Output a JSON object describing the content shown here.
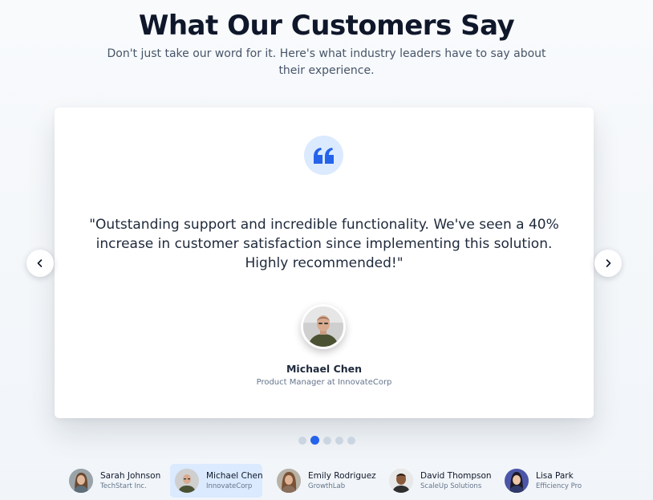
{
  "header": {
    "title": "What Our Customers Say",
    "subtitle": "Don't just take our word for it. Here's what industry leaders have to say about their experience."
  },
  "testimonial": {
    "quote_icon": "quote-icon",
    "quote": "\"Outstanding support and incredible functionality. We've seen a 40% increase in customer satisfaction since implementing this solution. Highly recommended!\"",
    "author_name": "Michael Chen",
    "author_role": "Product Manager at InnovateCorp"
  },
  "navigation": {
    "prev_icon": "chevron-left-icon",
    "next_icon": "chevron-right-icon"
  },
  "pagination": {
    "total": 5,
    "active_index": 1
  },
  "customers": [
    {
      "name": "Sarah Johnson",
      "company": "TechStart Inc.",
      "active": false
    },
    {
      "name": "Michael Chen",
      "company": "InnovateCorp",
      "active": true
    },
    {
      "name": "Emily Rodriguez",
      "company": "GrowthLab",
      "active": false
    },
    {
      "name": "David Thompson",
      "company": "ScaleUp Solutions",
      "active": false
    },
    {
      "name": "Lisa Park",
      "company": "Efficiency Pro",
      "active": false
    }
  ],
  "colors": {
    "accent": "#2563eb",
    "accent_light": "#dbeafe",
    "heading": "#0f172a",
    "muted": "#64748b"
  }
}
